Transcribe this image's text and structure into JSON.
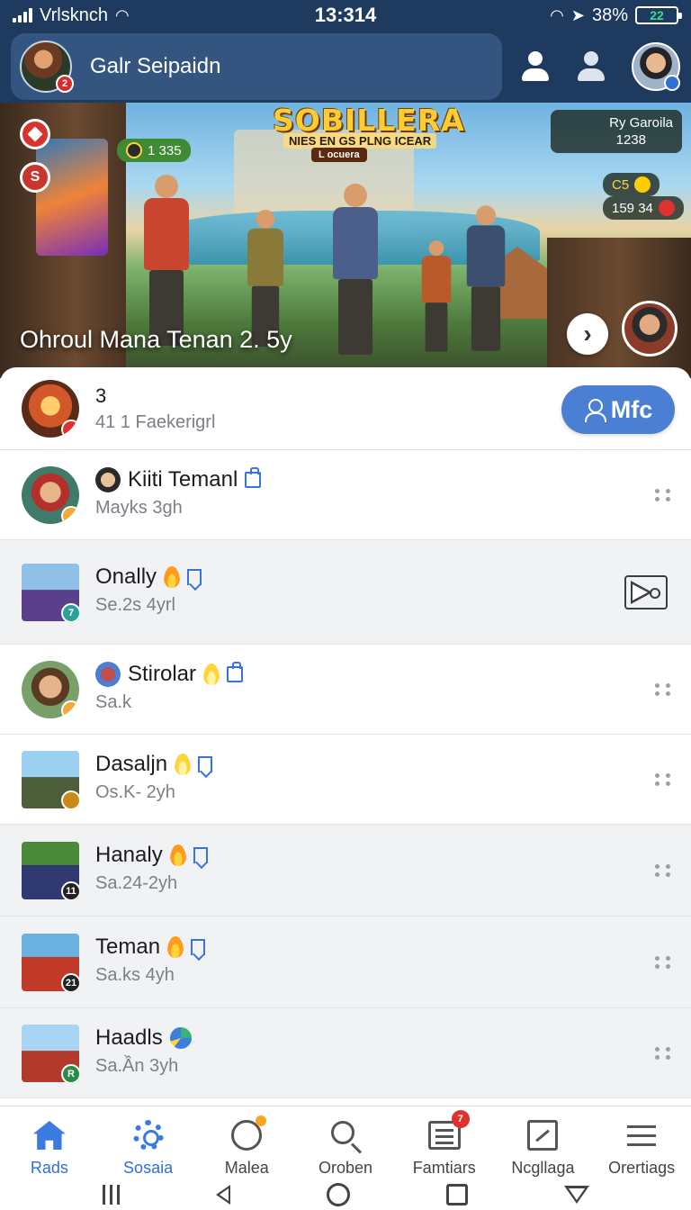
{
  "status_bar": {
    "carrier": "Vrlsknch",
    "time": "13:314",
    "battery_percent": "38%",
    "battery_level": "22"
  },
  "header": {
    "title": "Galr Seipaidn",
    "avatar_badge": "2"
  },
  "hero": {
    "logo": "SOBILLERA",
    "logo_subtitle": "NIES EN GS PLNG ICEAR",
    "tag": "L ocuera",
    "score_chip": "1 335",
    "opponent_name": "Ry Garoila",
    "opponent_score": "1238",
    "coins": "C5",
    "gems": "159 34",
    "caption": "Ohroul Mana Tenan 2. 5y"
  },
  "featured_row": {
    "title": "3",
    "subtitle": "41 1 Faekerigrl",
    "add_button_label": "Mfc"
  },
  "friends": [
    {
      "name": "Kiiti Temanl",
      "status": "Mayks 3gh",
      "icon": "bag-icon",
      "action": "more",
      "badge": ""
    },
    {
      "name": "Onally",
      "status": "Se.2s 4yrl",
      "icon": "bookmark-icon",
      "action": "video",
      "badge": "7"
    },
    {
      "name": "Stirolar",
      "status": "Sa.k",
      "icon": "bag-icon",
      "action": "more",
      "badge": ""
    },
    {
      "name": "Dasaljn",
      "status": "Os.K- 2yh",
      "icon": "bookmark-icon",
      "action": "more",
      "badge": ""
    },
    {
      "name": "Hanaly",
      "status": "Sa.24-2yh",
      "icon": "bookmark-icon",
      "action": "more",
      "badge": "11"
    },
    {
      "name": "Teman",
      "status": "Sa.ks 4yh",
      "icon": "bookmark-icon",
      "action": "more",
      "badge": "21"
    },
    {
      "name": "Haadls",
      "status": "Sa.Ần 3yh",
      "icon": "globe-icon",
      "action": "more",
      "badge": "R"
    }
  ],
  "bottom_nav": [
    {
      "label": "Rads",
      "icon": "home-icon",
      "active": true
    },
    {
      "label": "Sosaia",
      "icon": "gear-icon",
      "active": true
    },
    {
      "label": "Malea",
      "icon": "ball-icon",
      "active": false
    },
    {
      "label": "Oroben",
      "icon": "search-icon",
      "active": false
    },
    {
      "label": "Famtiars",
      "icon": "list-icon",
      "active": false,
      "badge": "7"
    },
    {
      "label": "Ncgllaga",
      "icon": "photo-icon",
      "active": false
    },
    {
      "label": "Orertiags",
      "icon": "menu-icon",
      "active": false
    }
  ],
  "colors": {
    "header": "#1f3a5f",
    "accent": "#4a7fd4"
  }
}
